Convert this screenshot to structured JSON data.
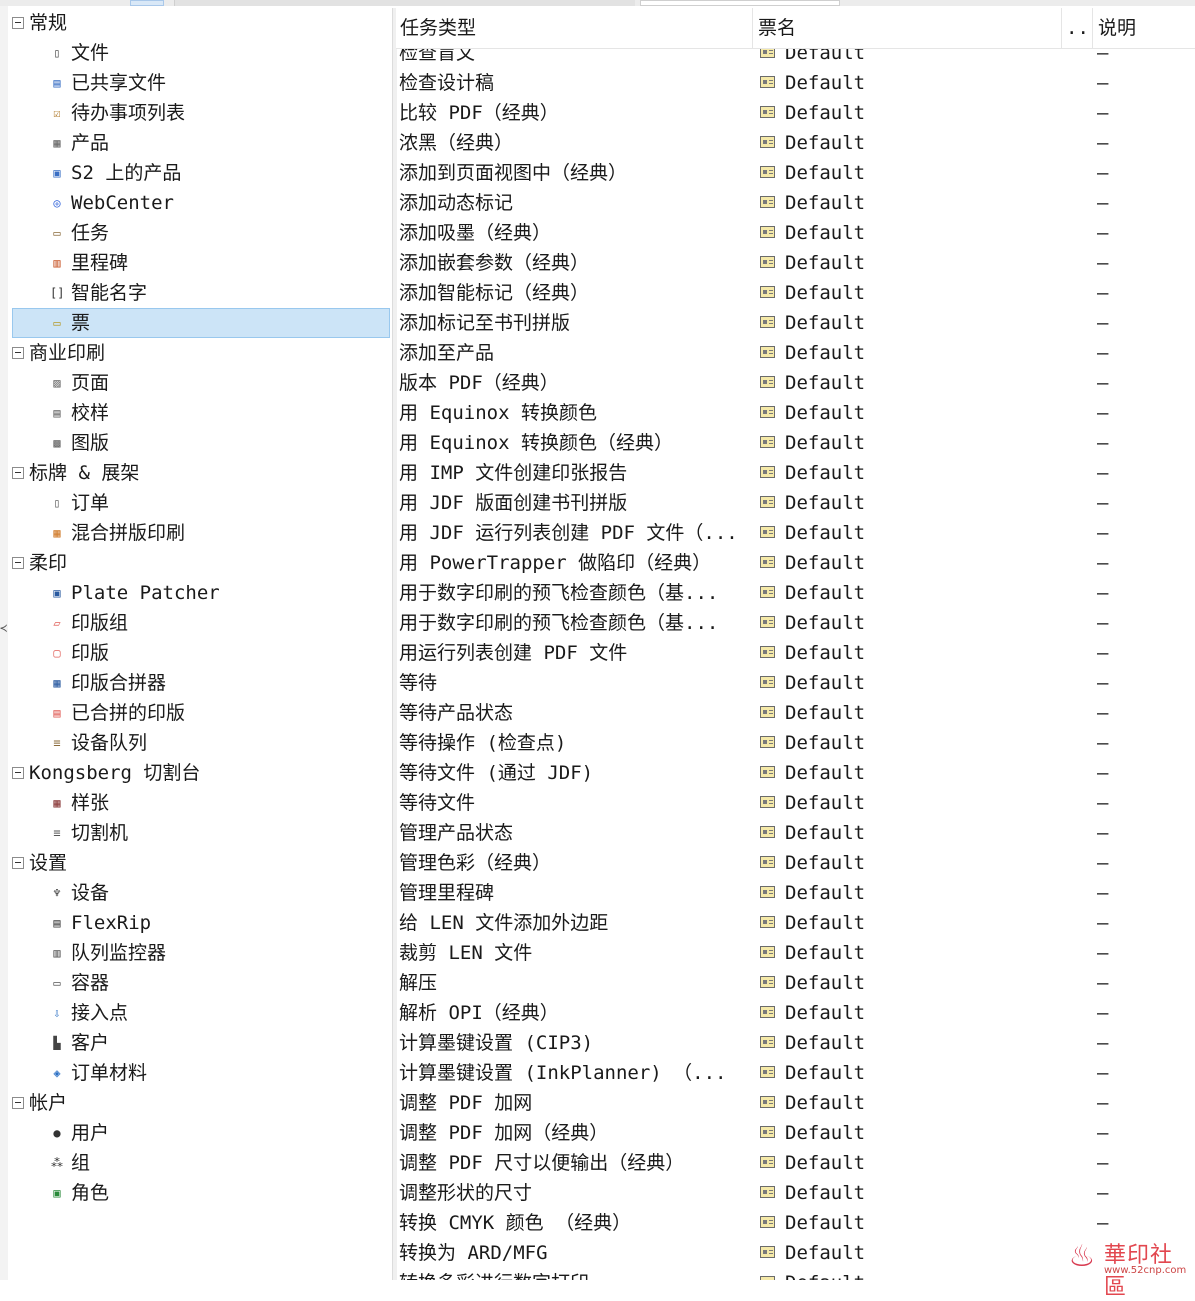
{
  "tree": {
    "sections": [
      {
        "label": "常规",
        "items": [
          {
            "label": "文件",
            "icon": "file-icon",
            "glyph": "▯",
            "color": "#555555"
          },
          {
            "label": "已共享文件",
            "icon": "shared-file-icon",
            "glyph": "▤",
            "color": "#3a6fc4"
          },
          {
            "label": "待办事项列表",
            "icon": "todo-list-icon",
            "glyph": "☑",
            "color": "#b07a2a"
          },
          {
            "label": "产品",
            "icon": "product-icon",
            "glyph": "▦",
            "color": "#666666"
          },
          {
            "label": "S2 上的产品",
            "icon": "cloud-product-icon",
            "glyph": "▣",
            "color": "#3a6fc4"
          },
          {
            "label": "WebCenter",
            "icon": "webcenter-icon",
            "glyph": "◎",
            "color": "#2b5fd9"
          },
          {
            "label": "任务",
            "icon": "task-icon",
            "glyph": "▭",
            "color": "#8a6a3a"
          },
          {
            "label": "里程碑",
            "icon": "milestone-icon",
            "glyph": "▥",
            "color": "#c8572a"
          },
          {
            "label": "智能名字",
            "icon": "smart-name-icon",
            "glyph": "[]",
            "color": "#333333"
          },
          {
            "label": "票",
            "icon": "ticket-icon",
            "glyph": "▭",
            "color": "#b59a2a",
            "selected": true
          }
        ]
      },
      {
        "label": "商业印刷",
        "items": [
          {
            "label": "页面",
            "icon": "page-icon",
            "glyph": "▨",
            "color": "#666666"
          },
          {
            "label": "校样",
            "icon": "proof-icon",
            "glyph": "▤",
            "color": "#666666"
          },
          {
            "label": "图版",
            "icon": "plate-icon",
            "glyph": "▩",
            "color": "#666666"
          }
        ]
      },
      {
        "label": "标牌 & 展架",
        "items": [
          {
            "label": "订单",
            "icon": "order-icon",
            "glyph": "▯",
            "color": "#666666"
          },
          {
            "label": "混合拼版印刷",
            "icon": "gang-print-icon",
            "glyph": "▦",
            "color": "#d07a2a"
          }
        ]
      },
      {
        "label": "柔印",
        "items": [
          {
            "label": "Plate Patcher",
            "icon": "plate-patcher-icon",
            "glyph": "▣",
            "color": "#2a5aa0"
          },
          {
            "label": "印版组",
            "icon": "plate-group-icon",
            "glyph": "▱",
            "color": "#e0605a"
          },
          {
            "label": "印版",
            "icon": "flexo-plate-icon",
            "glyph": "▢",
            "color": "#e0605a"
          },
          {
            "label": "印版合拼器",
            "icon": "plate-merger-icon",
            "glyph": "▦",
            "color": "#2a5aa0"
          },
          {
            "label": "已合拼的印版",
            "icon": "merged-plate-icon",
            "glyph": "▤",
            "color": "#e0605a"
          },
          {
            "label": "设备队列",
            "icon": "device-queue-icon",
            "glyph": "≡",
            "color": "#8a6a3a"
          }
        ]
      },
      {
        "label": "Kongsberg 切割台",
        "items": [
          {
            "label": "样张",
            "icon": "sample-sheet-icon",
            "glyph": "▦",
            "color": "#8a3a3a"
          },
          {
            "label": "切割机",
            "icon": "cutter-icon",
            "glyph": "≡",
            "color": "#555555"
          }
        ]
      },
      {
        "label": "设置",
        "items": [
          {
            "label": "设备",
            "icon": "device-plug-icon",
            "glyph": "♆",
            "color": "#333333"
          },
          {
            "label": "FlexRip",
            "icon": "flexrip-icon",
            "glyph": "▤",
            "color": "#444444"
          },
          {
            "label": "队列监控器",
            "icon": "queue-monitor-icon",
            "glyph": "▥",
            "color": "#555555"
          },
          {
            "label": "容器",
            "icon": "container-icon",
            "glyph": "▭",
            "color": "#555555"
          },
          {
            "label": "接入点",
            "icon": "access-point-icon",
            "glyph": "⇩",
            "color": "#2a6fc4"
          },
          {
            "label": "客户",
            "icon": "customer-icon",
            "glyph": "▙",
            "color": "#444444"
          },
          {
            "label": "订单材料",
            "icon": "order-material-icon",
            "glyph": "◈",
            "color": "#2a6fc4"
          }
        ]
      },
      {
        "label": "帐户",
        "items": [
          {
            "label": "用户",
            "icon": "user-icon",
            "glyph": "●",
            "color": "#333333"
          },
          {
            "label": "组",
            "icon": "group-icon",
            "glyph": "⁂",
            "color": "#333333"
          },
          {
            "label": "角色",
            "icon": "role-card-icon",
            "glyph": "▣",
            "color": "#2a8a3a"
          }
        ]
      }
    ]
  },
  "table": {
    "headers": {
      "type": "任务类型",
      "ticket": "票名",
      "more": "..",
      "desc": "说明"
    },
    "rows": [
      {
        "type": "检查盲文",
        "ticket": "Default",
        "desc": "–"
      },
      {
        "type": "检查设计稿",
        "ticket": "Default",
        "desc": "–"
      },
      {
        "type": "比较 PDF（经典）",
        "ticket": "Default",
        "desc": "–"
      },
      {
        "type": "浓黑（经典）",
        "ticket": "Default",
        "desc": "–"
      },
      {
        "type": "添加到页面视图中（经典）",
        "ticket": "Default",
        "desc": "–"
      },
      {
        "type": "添加动态标记",
        "ticket": "Default",
        "desc": "–"
      },
      {
        "type": "添加吸墨（经典）",
        "ticket": "Default",
        "desc": "–"
      },
      {
        "type": "添加嵌套参数（经典）",
        "ticket": "Default",
        "desc": "–"
      },
      {
        "type": "添加智能标记（经典）",
        "ticket": "Default",
        "desc": "–"
      },
      {
        "type": "添加标记至书刊拼版",
        "ticket": "Default",
        "desc": "–"
      },
      {
        "type": "添加至产品",
        "ticket": "Default",
        "desc": "–"
      },
      {
        "type": "版本 PDF（经典）",
        "ticket": "Default",
        "desc": "–"
      },
      {
        "type": "用 Equinox 转换颜色",
        "ticket": "Default",
        "desc": "–"
      },
      {
        "type": "用 Equinox 转换颜色（经典）",
        "ticket": "Default",
        "desc": "–"
      },
      {
        "type": "用 IMP 文件创建印张报告",
        "ticket": "Default",
        "desc": "–"
      },
      {
        "type": "用 JDF 版面创建书刊拼版",
        "ticket": "Default",
        "desc": "–"
      },
      {
        "type": "用 JDF 运行列表创建 PDF 文件（...",
        "ticket": "Default",
        "desc": "–"
      },
      {
        "type": "用 PowerTrapper 做陷印（经典）",
        "ticket": "Default",
        "desc": "–"
      },
      {
        "type": "用于数字印刷的预飞检查颜色（基...",
        "ticket": "Default",
        "desc": "–"
      },
      {
        "type": "用于数字印刷的预飞检查颜色（基...",
        "ticket": "Default",
        "desc": "–"
      },
      {
        "type": "用运行列表创建 PDF 文件",
        "ticket": "Default",
        "desc": "–"
      },
      {
        "type": "等待",
        "ticket": "Default",
        "desc": "–"
      },
      {
        "type": "等待产品状态",
        "ticket": "Default",
        "desc": "–"
      },
      {
        "type": "等待操作 (检查点)",
        "ticket": "Default",
        "desc": "–"
      },
      {
        "type": "等待文件 (通过 JDF)",
        "ticket": "Default",
        "desc": "–"
      },
      {
        "type": "等待文件",
        "ticket": "Default",
        "desc": "–"
      },
      {
        "type": "管理产品状态",
        "ticket": "Default",
        "desc": "–"
      },
      {
        "type": "管理色彩（经典）",
        "ticket": "Default",
        "desc": "–"
      },
      {
        "type": "管理里程碑",
        "ticket": "Default",
        "desc": "–"
      },
      {
        "type": "给 LEN 文件添加外边距",
        "ticket": "Default",
        "desc": "–"
      },
      {
        "type": "裁剪 LEN 文件",
        "ticket": "Default",
        "desc": "–"
      },
      {
        "type": "解压",
        "ticket": "Default",
        "desc": "–"
      },
      {
        "type": "解析 OPI（经典）",
        "ticket": "Default",
        "desc": "–"
      },
      {
        "type": "计算墨键设置 (CIP3)",
        "ticket": "Default",
        "desc": "–"
      },
      {
        "type": "计算墨键设置 (InkPlanner) （...",
        "ticket": "Default",
        "desc": "–"
      },
      {
        "type": "调整 PDF 加网",
        "ticket": "Default",
        "desc": "–"
      },
      {
        "type": "调整 PDF 加网（经典）",
        "ticket": "Default",
        "desc": "–"
      },
      {
        "type": "调整 PDF 尺寸以便输出（经典）",
        "ticket": "Default",
        "desc": "–"
      },
      {
        "type": "调整形状的尺寸",
        "ticket": "Default",
        "desc": "–"
      },
      {
        "type": "转换 CMYK 颜色 （经典）",
        "ticket": "Default",
        "desc": "–"
      },
      {
        "type": "转换为 ARD/MFG",
        "ticket": "Default",
        "desc": ""
      },
      {
        "type": "转换多彩进行数字打印",
        "ticket": "Default",
        "desc": ""
      }
    ]
  },
  "watermark": {
    "name": "華印社區",
    "url": "www.52cnp.com",
    "logo_glyph": "♨"
  },
  "colors": {
    "selection_bg": "#cce4f7",
    "selection_border": "#99c8ee",
    "ticket_icon_fill": "#f5e9a8"
  }
}
